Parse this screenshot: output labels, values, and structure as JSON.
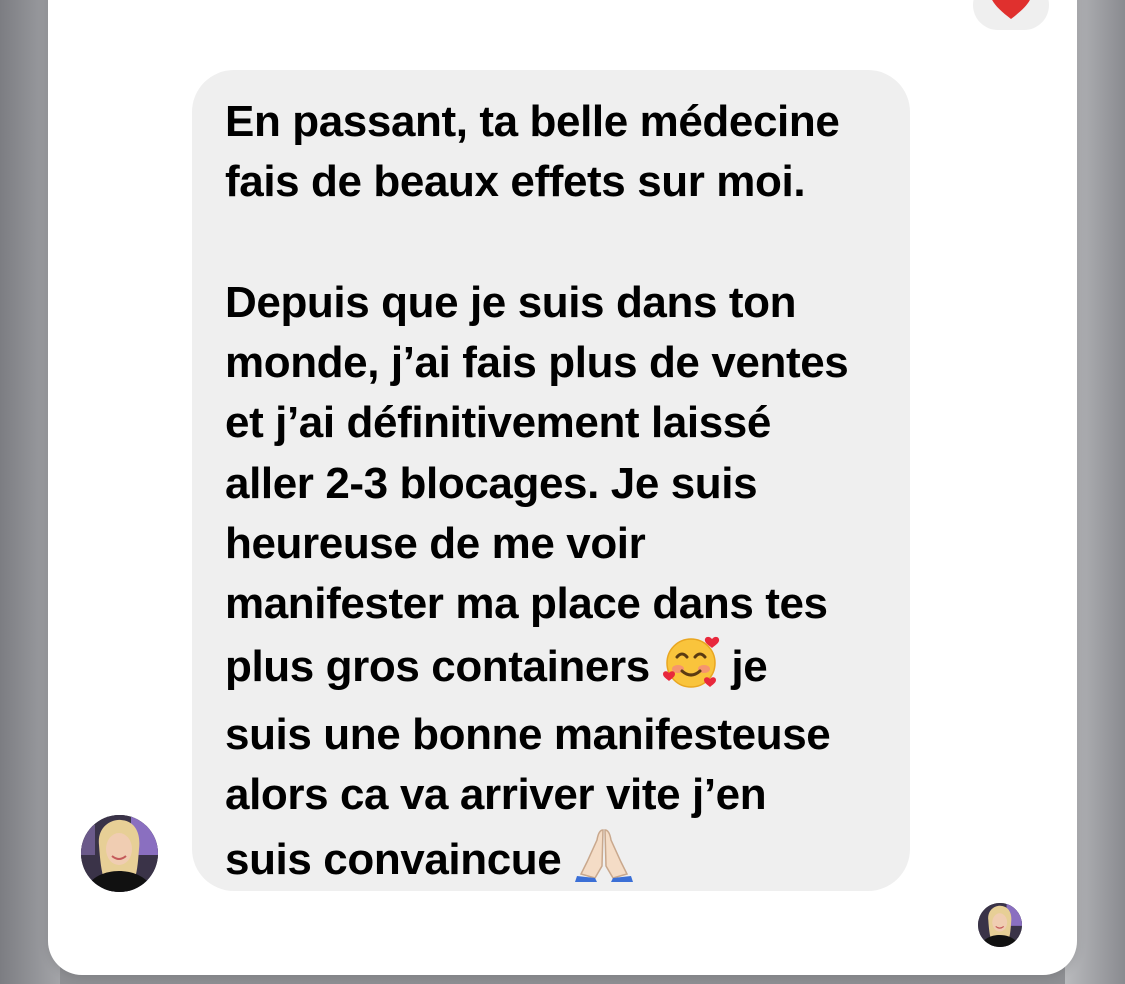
{
  "message": {
    "segments": [
      "En passant, ta belle médecine\nfais de beaux effets sur moi.\n\nDepuis que je suis dans ton\nmonde, j’ai fais plus de ventes\net j’ai définitivement laissé\naller 2-3 blocages. Je suis\nheureuse de me voir\nmanifester ma place dans tes\nplus gros containers ",
      " je\nsuis une bonne manifesteuse\nalors ca va arriver vite j’en\nsuis convaincue "
    ],
    "emojis": [
      "smiling-face-with-hearts",
      "folded-hands"
    ]
  },
  "reaction": {
    "icon": "heart-icon",
    "color": "#e0302e"
  },
  "colors": {
    "bubble": "#efefef",
    "card": "#ffffff",
    "text": "#000000"
  }
}
